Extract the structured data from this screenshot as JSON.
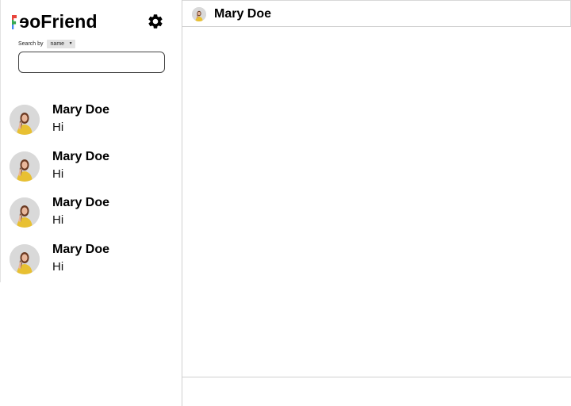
{
  "app": {
    "logo_text": "Friend",
    "logo_mirrored": "oe"
  },
  "search": {
    "by_label": "Search by",
    "by_value": "name",
    "placeholder": ""
  },
  "chats": [
    {
      "name": "Mary Doe",
      "message": "Hi"
    },
    {
      "name": "Mary Doe",
      "message": "Hi"
    },
    {
      "name": "Mary Doe",
      "message": "Hi"
    },
    {
      "name": "Mary Doe",
      "message": "Hi"
    }
  ],
  "conversation": {
    "contact_name": "Mary Doe"
  },
  "icons": {
    "settings": "gear-icon",
    "avatar": "avatar",
    "dropdown": "chevron-down-icon"
  },
  "colors": {
    "logo_f": [
      "#e8453c",
      "#34a853",
      "#4285f4"
    ],
    "avatar_bg": "#d9d9d9",
    "avatar_sweater": "#e8c032"
  }
}
